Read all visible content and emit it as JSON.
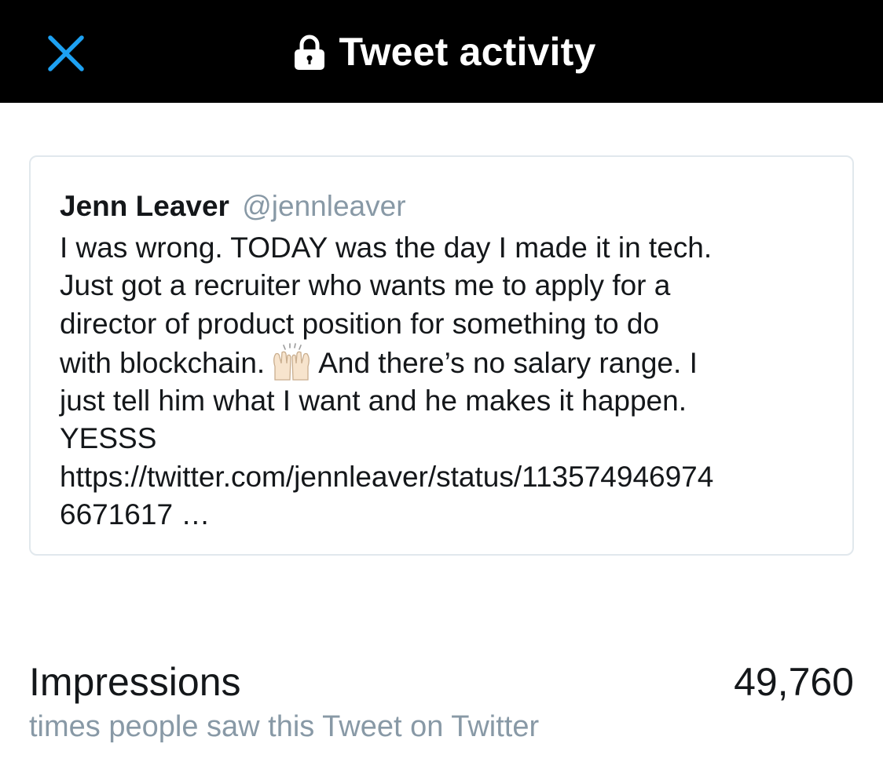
{
  "header": {
    "title": "Tweet activity",
    "close_icon": "close-icon",
    "lock_icon": "lock-icon",
    "accent_color": "#1da1f2"
  },
  "tweet": {
    "author_name": "Jenn Leaver",
    "author_handle": "@jennleaver",
    "lines": [
      "I was wrong. TODAY was the day I made it in tech.",
      "Just got a recruiter who wants me to apply for a",
      "director of product position for something to do"
    ],
    "line4_before_emoji": "with blockchain.",
    "emoji": "raising-hands-emoji",
    "line4_after_emoji": "And there’s no salary range. I",
    "lines_after": [
      "just tell him what I want and he makes it happen.",
      "YESSS",
      "https://twitter.com/jennleaver/status/113574946974",
      "6671617 …"
    ]
  },
  "metric": {
    "label": "Impressions",
    "description": "times people saw this Tweet on Twitter",
    "value": "49,760"
  }
}
